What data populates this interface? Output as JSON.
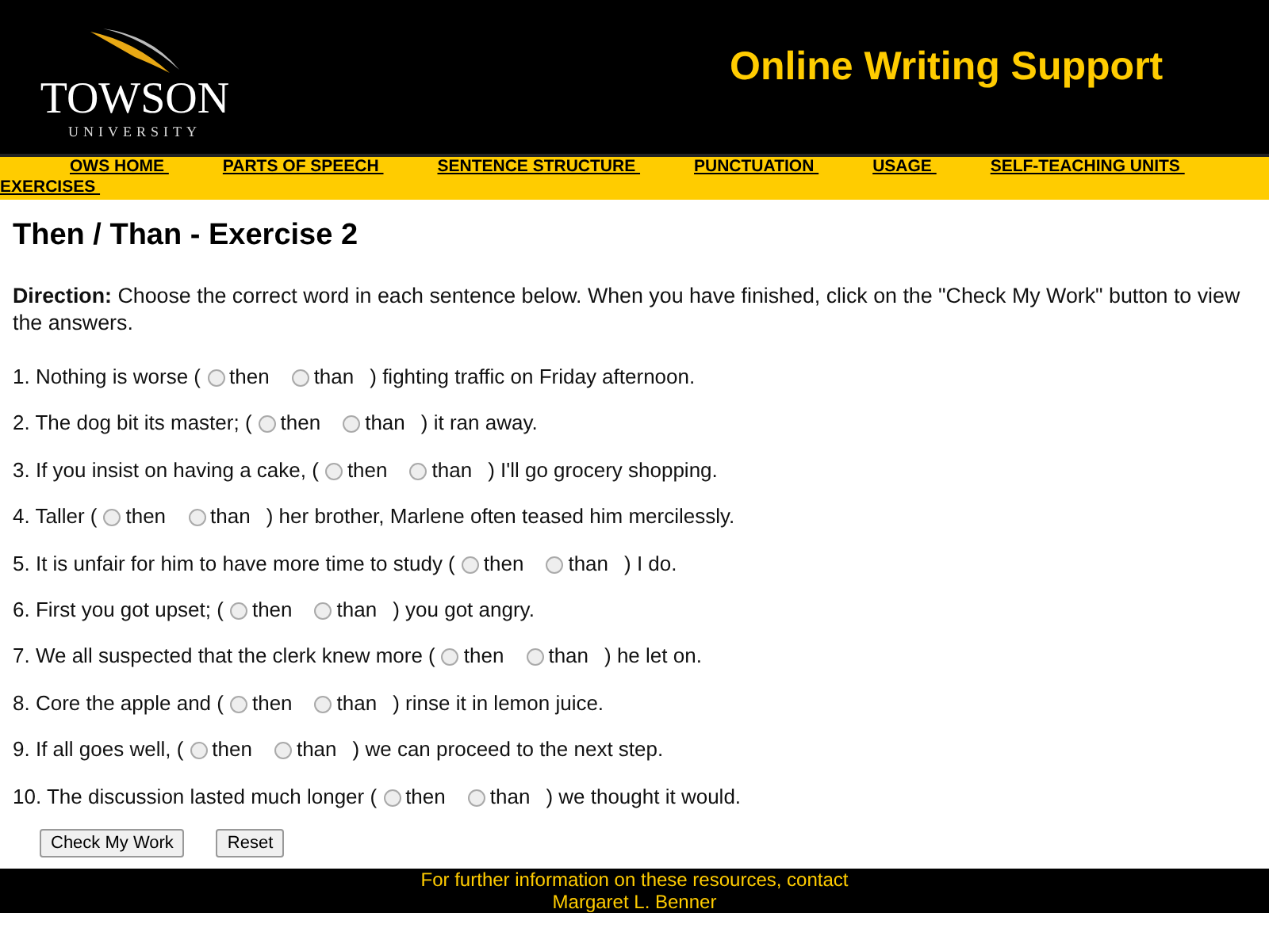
{
  "header": {
    "logo_name": "TOWSON",
    "logo_sub": "UNIVERSITY",
    "site_title": "Online Writing Support"
  },
  "nav": [
    "OWS HOME",
    "PARTS OF SPEECH",
    "SENTENCE STRUCTURE",
    "PUNCTUATION",
    "USAGE",
    "SELF-TEACHING UNITS",
    "EXERCISES"
  ],
  "title": "Then / Than - Exercise 2",
  "direction": "**Direction:** Choose the correct word in each sentence below. When you have finished, click on the \"Check My Work\" button to view the answers.",
  "questions": [
    {
      "before": "1. Nothing is worse (",
      "options": [
        {
          "label": "then",
          "selected": false
        },
        {
          "label": "than",
          "selected": false
        }
      ],
      "after": ") fighting traffic on Friday afternoon."
    },
    {
      "before": "2. The dog bit its master; (",
      "options": [
        {
          "label": "then",
          "selected": false
        },
        {
          "label": "than",
          "selected": false
        }
      ],
      "after": ") it ran away."
    },
    {
      "before": "3. If you insist on having a cake, (",
      "options": [
        {
          "label": "then",
          "selected": false
        },
        {
          "label": "than",
          "selected": false
        }
      ],
      "after": ") I'll go grocery shopping."
    },
    {
      "before": "4. Taller (",
      "options": [
        {
          "label": "then",
          "selected": false
        },
        {
          "label": "than",
          "selected": false
        }
      ],
      "after": ") her brother, Marlene often teased him mercilessly."
    },
    {
      "before": "5. It is unfair for him to have more time to study (",
      "options": [
        {
          "label": "then",
          "selected": false
        },
        {
          "label": "than",
          "selected": false
        }
      ],
      "after": ") I do."
    },
    {
      "before": "6. First you got upset; (",
      "options": [
        {
          "label": "then",
          "selected": false
        },
        {
          "label": "than",
          "selected": false
        }
      ],
      "after": ") you got angry."
    },
    {
      "before": "7. We all suspected that the clerk knew more (",
      "options": [
        {
          "label": "then",
          "selected": false
        },
        {
          "label": "than",
          "selected": false
        }
      ],
      "after": ") he let on."
    },
    {
      "before": "8. Core the apple and (",
      "options": [
        {
          "label": "then",
          "selected": false
        },
        {
          "label": "than",
          "selected": false
        }
      ],
      "after": ") rinse it in lemon juice."
    },
    {
      "before": "9. If all goes well, (",
      "options": [
        {
          "label": "then",
          "selected": false
        },
        {
          "label": "than",
          "selected": false
        }
      ],
      "after": ") we can proceed to the next step."
    },
    {
      "before": "10. The discussion lasted much longer (",
      "options": [
        {
          "label": "then",
          "selected": false
        },
        {
          "label": "than",
          "selected": false
        }
      ],
      "after": ") we thought it would."
    }
  ],
  "buttons": [
    "Check My Work",
    "Reset"
  ],
  "footer": [
    "For further information on these resources, contact",
    "Margaret L. Benner"
  ]
}
